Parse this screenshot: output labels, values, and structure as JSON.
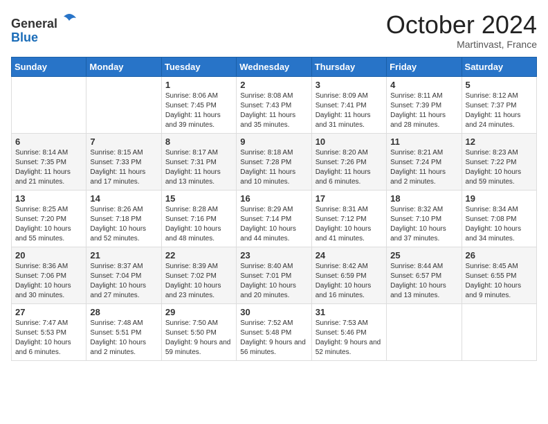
{
  "header": {
    "logo_general": "General",
    "logo_blue": "Blue",
    "month_title": "October 2024",
    "location": "Martinvast, France"
  },
  "days_of_week": [
    "Sunday",
    "Monday",
    "Tuesday",
    "Wednesday",
    "Thursday",
    "Friday",
    "Saturday"
  ],
  "weeks": [
    [
      {
        "day": "",
        "sunrise": "",
        "sunset": "",
        "daylight": ""
      },
      {
        "day": "",
        "sunrise": "",
        "sunset": "",
        "daylight": ""
      },
      {
        "day": "1",
        "sunrise": "Sunrise: 8:06 AM",
        "sunset": "Sunset: 7:45 PM",
        "daylight": "Daylight: 11 hours and 39 minutes."
      },
      {
        "day": "2",
        "sunrise": "Sunrise: 8:08 AM",
        "sunset": "Sunset: 7:43 PM",
        "daylight": "Daylight: 11 hours and 35 minutes."
      },
      {
        "day": "3",
        "sunrise": "Sunrise: 8:09 AM",
        "sunset": "Sunset: 7:41 PM",
        "daylight": "Daylight: 11 hours and 31 minutes."
      },
      {
        "day": "4",
        "sunrise": "Sunrise: 8:11 AM",
        "sunset": "Sunset: 7:39 PM",
        "daylight": "Daylight: 11 hours and 28 minutes."
      },
      {
        "day": "5",
        "sunrise": "Sunrise: 8:12 AM",
        "sunset": "Sunset: 7:37 PM",
        "daylight": "Daylight: 11 hours and 24 minutes."
      }
    ],
    [
      {
        "day": "6",
        "sunrise": "Sunrise: 8:14 AM",
        "sunset": "Sunset: 7:35 PM",
        "daylight": "Daylight: 11 hours and 21 minutes."
      },
      {
        "day": "7",
        "sunrise": "Sunrise: 8:15 AM",
        "sunset": "Sunset: 7:33 PM",
        "daylight": "Daylight: 11 hours and 17 minutes."
      },
      {
        "day": "8",
        "sunrise": "Sunrise: 8:17 AM",
        "sunset": "Sunset: 7:31 PM",
        "daylight": "Daylight: 11 hours and 13 minutes."
      },
      {
        "day": "9",
        "sunrise": "Sunrise: 8:18 AM",
        "sunset": "Sunset: 7:28 PM",
        "daylight": "Daylight: 11 hours and 10 minutes."
      },
      {
        "day": "10",
        "sunrise": "Sunrise: 8:20 AM",
        "sunset": "Sunset: 7:26 PM",
        "daylight": "Daylight: 11 hours and 6 minutes."
      },
      {
        "day": "11",
        "sunrise": "Sunrise: 8:21 AM",
        "sunset": "Sunset: 7:24 PM",
        "daylight": "Daylight: 11 hours and 2 minutes."
      },
      {
        "day": "12",
        "sunrise": "Sunrise: 8:23 AM",
        "sunset": "Sunset: 7:22 PM",
        "daylight": "Daylight: 10 hours and 59 minutes."
      }
    ],
    [
      {
        "day": "13",
        "sunrise": "Sunrise: 8:25 AM",
        "sunset": "Sunset: 7:20 PM",
        "daylight": "Daylight: 10 hours and 55 minutes."
      },
      {
        "day": "14",
        "sunrise": "Sunrise: 8:26 AM",
        "sunset": "Sunset: 7:18 PM",
        "daylight": "Daylight: 10 hours and 52 minutes."
      },
      {
        "day": "15",
        "sunrise": "Sunrise: 8:28 AM",
        "sunset": "Sunset: 7:16 PM",
        "daylight": "Daylight: 10 hours and 48 minutes."
      },
      {
        "day": "16",
        "sunrise": "Sunrise: 8:29 AM",
        "sunset": "Sunset: 7:14 PM",
        "daylight": "Daylight: 10 hours and 44 minutes."
      },
      {
        "day": "17",
        "sunrise": "Sunrise: 8:31 AM",
        "sunset": "Sunset: 7:12 PM",
        "daylight": "Daylight: 10 hours and 41 minutes."
      },
      {
        "day": "18",
        "sunrise": "Sunrise: 8:32 AM",
        "sunset": "Sunset: 7:10 PM",
        "daylight": "Daylight: 10 hours and 37 minutes."
      },
      {
        "day": "19",
        "sunrise": "Sunrise: 8:34 AM",
        "sunset": "Sunset: 7:08 PM",
        "daylight": "Daylight: 10 hours and 34 minutes."
      }
    ],
    [
      {
        "day": "20",
        "sunrise": "Sunrise: 8:36 AM",
        "sunset": "Sunset: 7:06 PM",
        "daylight": "Daylight: 10 hours and 30 minutes."
      },
      {
        "day": "21",
        "sunrise": "Sunrise: 8:37 AM",
        "sunset": "Sunset: 7:04 PM",
        "daylight": "Daylight: 10 hours and 27 minutes."
      },
      {
        "day": "22",
        "sunrise": "Sunrise: 8:39 AM",
        "sunset": "Sunset: 7:02 PM",
        "daylight": "Daylight: 10 hours and 23 minutes."
      },
      {
        "day": "23",
        "sunrise": "Sunrise: 8:40 AM",
        "sunset": "Sunset: 7:01 PM",
        "daylight": "Daylight: 10 hours and 20 minutes."
      },
      {
        "day": "24",
        "sunrise": "Sunrise: 8:42 AM",
        "sunset": "Sunset: 6:59 PM",
        "daylight": "Daylight: 10 hours and 16 minutes."
      },
      {
        "day": "25",
        "sunrise": "Sunrise: 8:44 AM",
        "sunset": "Sunset: 6:57 PM",
        "daylight": "Daylight: 10 hours and 13 minutes."
      },
      {
        "day": "26",
        "sunrise": "Sunrise: 8:45 AM",
        "sunset": "Sunset: 6:55 PM",
        "daylight": "Daylight: 10 hours and 9 minutes."
      }
    ],
    [
      {
        "day": "27",
        "sunrise": "Sunrise: 7:47 AM",
        "sunset": "Sunset: 5:53 PM",
        "daylight": "Daylight: 10 hours and 6 minutes."
      },
      {
        "day": "28",
        "sunrise": "Sunrise: 7:48 AM",
        "sunset": "Sunset: 5:51 PM",
        "daylight": "Daylight: 10 hours and 2 minutes."
      },
      {
        "day": "29",
        "sunrise": "Sunrise: 7:50 AM",
        "sunset": "Sunset: 5:50 PM",
        "daylight": "Daylight: 9 hours and 59 minutes."
      },
      {
        "day": "30",
        "sunrise": "Sunrise: 7:52 AM",
        "sunset": "Sunset: 5:48 PM",
        "daylight": "Daylight: 9 hours and 56 minutes."
      },
      {
        "day": "31",
        "sunrise": "Sunrise: 7:53 AM",
        "sunset": "Sunset: 5:46 PM",
        "daylight": "Daylight: 9 hours and 52 minutes."
      },
      {
        "day": "",
        "sunrise": "",
        "sunset": "",
        "daylight": ""
      },
      {
        "day": "",
        "sunrise": "",
        "sunset": "",
        "daylight": ""
      }
    ]
  ]
}
